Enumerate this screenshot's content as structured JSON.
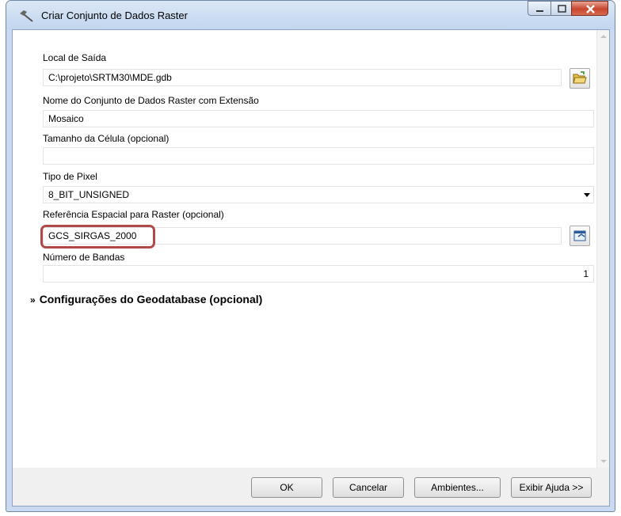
{
  "window": {
    "title": "Criar Conjunto de Dados Raster",
    "icon": "hammer-icon"
  },
  "form": {
    "output_location": {
      "label": "Local de Saída",
      "value": "C:\\projeto\\SRTM30\\MDE.gdb"
    },
    "dataset_name": {
      "label": "Nome do Conjunto de Dados Raster com Extensão",
      "value": "Mosaico"
    },
    "cell_size": {
      "label": "Tamanho da Célula (opcional)",
      "value": ""
    },
    "pixel_type": {
      "label": "Tipo de Pixel",
      "value": "8_BIT_UNSIGNED"
    },
    "spatial_reference": {
      "label": "Referência Espacial para Raster (opcional)",
      "value": "GCS_SIRGAS_2000"
    },
    "band_count": {
      "label": "Número de Bandas",
      "value": "1"
    },
    "geodatabase_settings": {
      "label": "Configurações do Geodatabase (opcional)"
    }
  },
  "buttons": {
    "ok": "OK",
    "cancel": "Cancelar",
    "environments": "Ambientes...",
    "help": "Exibir Ajuda >>"
  },
  "colors": {
    "highlight": "#b04a4a",
    "frame": "#c9daf0",
    "close": "#c7462d"
  }
}
